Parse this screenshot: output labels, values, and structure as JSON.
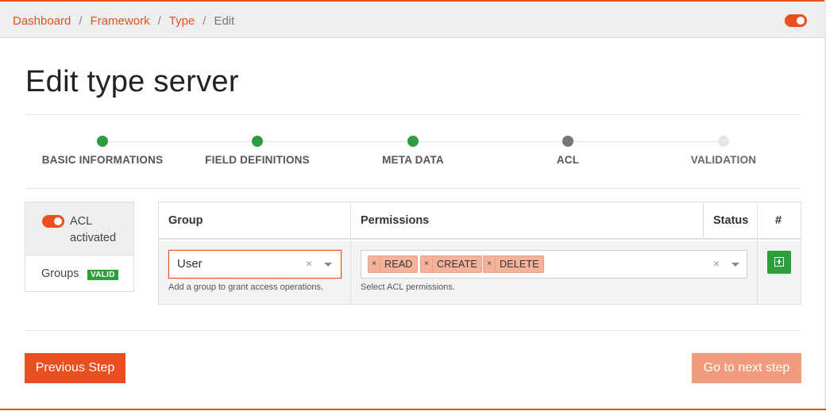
{
  "breadcrumb": {
    "items": [
      "Dashboard",
      "Framework",
      "Type"
    ],
    "current": "Edit",
    "separator": "/"
  },
  "page": {
    "title": "Edit type server"
  },
  "stepper": {
    "steps": [
      {
        "label": "BASIC INFORMATIONS",
        "state": "done"
      },
      {
        "label": "FIELD DEFINITIONS",
        "state": "done"
      },
      {
        "label": "META DATA",
        "state": "done"
      },
      {
        "label": "ACL",
        "state": "active"
      },
      {
        "label": "VALIDATION",
        "state": "todo"
      }
    ]
  },
  "sidebar": {
    "acl_label": "ACL activated",
    "acl_toggle_on": true,
    "groups_label": "Groups",
    "groups_badge": "VALID"
  },
  "table": {
    "headers": {
      "group": "Group",
      "permissions": "Permissions",
      "status": "Status",
      "actions": "#"
    },
    "row": {
      "group_value": "User",
      "group_help": "Add a group to grant access operations.",
      "permissions": [
        "READ",
        "CREATE",
        "DELETE"
      ],
      "permissions_help": "Select ACL permissions.",
      "clear_symbol": "×",
      "tag_remove_symbol": "×"
    }
  },
  "footer": {
    "previous_label": "Previous Step",
    "next_label": "Go to next step"
  },
  "colors": {
    "accent": "#e8511f",
    "success": "#2e9e3c",
    "tag_bg": "#f4b29b",
    "next_disabled": "#f29b7c"
  },
  "icons": {
    "top_toggle": "toggle-on-icon",
    "add": "plus-square-icon",
    "dropdown": "chevron-down-icon",
    "clear": "close-icon"
  }
}
